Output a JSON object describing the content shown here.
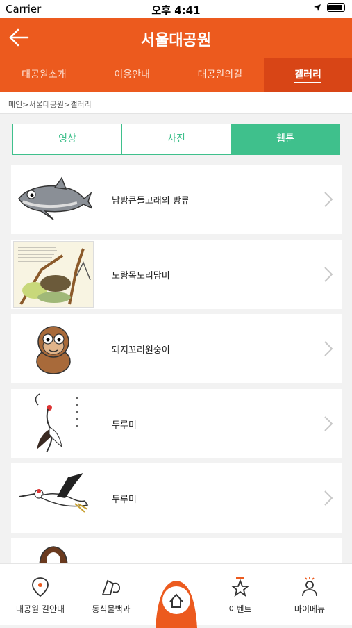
{
  "status": {
    "carrier": "Carrier",
    "time": "오후 4:41"
  },
  "header": {
    "title": "서울대공원"
  },
  "tabs": [
    {
      "label": "대공원소개"
    },
    {
      "label": "이용안내"
    },
    {
      "label": "대공원의길"
    },
    {
      "label": "갤러리"
    }
  ],
  "breadcrumb": "메인>서울대공원>갤러리",
  "segments": [
    {
      "label": "영상"
    },
    {
      "label": "사진"
    },
    {
      "label": "웹툰"
    }
  ],
  "items": [
    {
      "title": "남방큰돌고래의 방류",
      "icon": "dolphin-illustration"
    },
    {
      "title": "노랑목도리담비",
      "icon": "marten-illustration"
    },
    {
      "title": "돼지꼬리원숭이",
      "icon": "monkey-illustration"
    },
    {
      "title": "두루미",
      "icon": "crane-illustration"
    },
    {
      "title": "두루미",
      "icon": "flying-crane-illustration"
    }
  ],
  "bottom_nav": [
    {
      "label": "대공원 길안내",
      "icon": "map-pin-icon"
    },
    {
      "label": "동식물백과",
      "icon": "encyclopedia-icon"
    },
    {
      "label": "",
      "icon": "home-icon"
    },
    {
      "label": "이벤트",
      "icon": "star-icon"
    },
    {
      "label": "마이메뉴",
      "icon": "person-icon"
    }
  ],
  "colors": {
    "primary": "#ec5a1e",
    "active_tab": "#d84516",
    "accent": "#3fc08c"
  }
}
